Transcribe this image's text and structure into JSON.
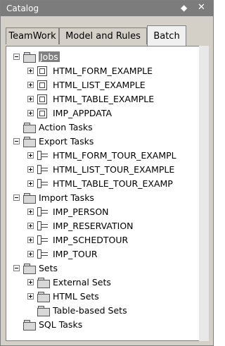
{
  "window": {
    "title": "Catalog"
  },
  "tabs": [
    "TeamWork",
    "Model and Rules",
    "Batch"
  ],
  "tree": [
    {
      "label": "Jobs",
      "level": 1,
      "expander": "minus",
      "icon": "folder-icon",
      "selected": true
    },
    {
      "label": "HTML_FORM_EXAMPLE",
      "level": 2,
      "expander": "plus",
      "icon": "job-icon"
    },
    {
      "label": "HTML_LIST_EXAMPLE",
      "level": 2,
      "expander": "plus",
      "icon": "job-icon"
    },
    {
      "label": "HTML_TABLE_EXAMPLE",
      "level": 2,
      "expander": "plus",
      "icon": "job-icon"
    },
    {
      "label": "IMP_APPDATA",
      "level": 2,
      "expander": "plus",
      "icon": "job-icon"
    },
    {
      "label": "Action Tasks",
      "level": 1,
      "expander": null,
      "icon": "folder-icon"
    },
    {
      "label": "Export Tasks",
      "level": 1,
      "expander": "minus",
      "icon": "folder-icon"
    },
    {
      "label": "HTML_FORM_TOUR_EXAMPL",
      "level": 2,
      "expander": "plus",
      "icon": "task-icon"
    },
    {
      "label": "HTML_LIST_TOUR_EXAMPLE",
      "level": 2,
      "expander": "plus",
      "icon": "task-icon"
    },
    {
      "label": "HTML_TABLE_TOUR_EXAMP",
      "level": 2,
      "expander": "plus",
      "icon": "task-icon"
    },
    {
      "label": "Import Tasks",
      "level": 1,
      "expander": "minus",
      "icon": "folder-icon"
    },
    {
      "label": "IMP_PERSON",
      "level": 2,
      "expander": "plus",
      "icon": "task-icon"
    },
    {
      "label": "IMP_RESERVATION",
      "level": 2,
      "expander": "plus",
      "icon": "task-icon"
    },
    {
      "label": "IMP_SCHEDTOUR",
      "level": 2,
      "expander": "plus",
      "icon": "task-icon"
    },
    {
      "label": "IMP_TOUR",
      "level": 2,
      "expander": "plus",
      "icon": "task-icon"
    },
    {
      "label": "Sets",
      "level": 1,
      "expander": "minus",
      "icon": "folder-icon"
    },
    {
      "label": "External Sets",
      "level": 2,
      "expander": "plus",
      "icon": "folder-icon"
    },
    {
      "label": "HTML Sets",
      "level": 2,
      "expander": "plus",
      "icon": "folder-icon"
    },
    {
      "label": "Table-based Sets",
      "level": 2,
      "expander": null,
      "icon": "folder-icon"
    },
    {
      "label": "SQL Tasks",
      "level": 1,
      "expander": null,
      "icon": "folder-icon"
    }
  ]
}
